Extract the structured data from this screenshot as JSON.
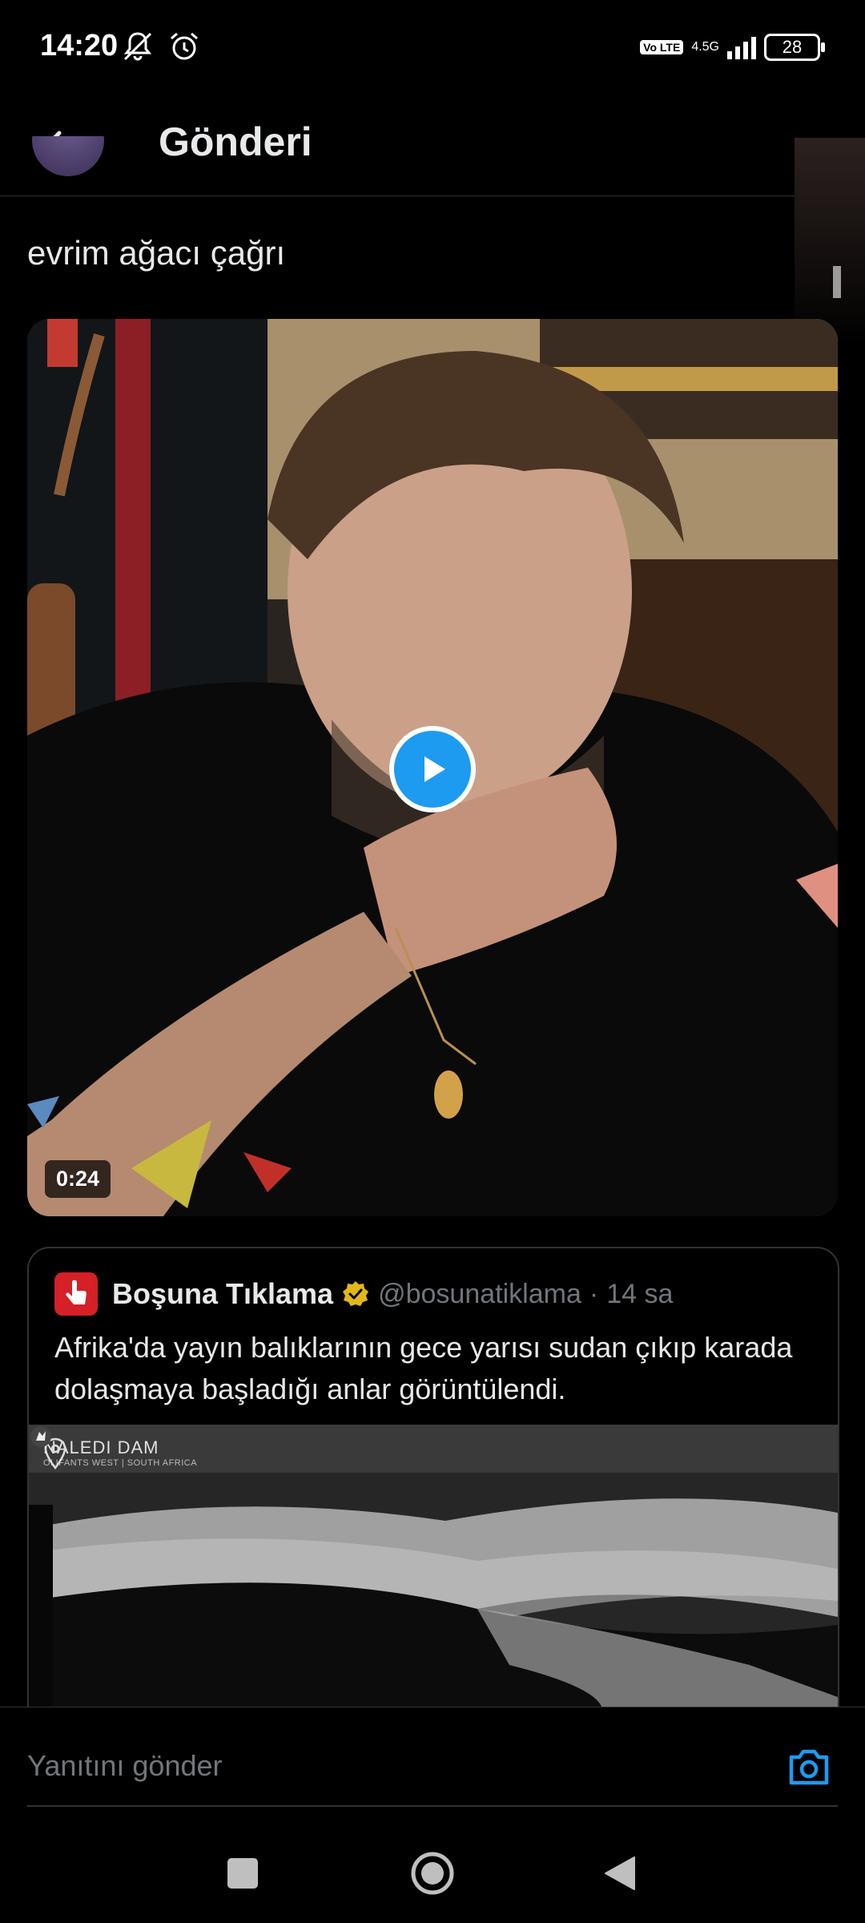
{
  "status_bar": {
    "time": "14:20",
    "network": "4.5G",
    "volte": "Vo LTE",
    "battery": "28"
  },
  "header": {
    "title": "Gönderi"
  },
  "tweet": {
    "text": "evrim ağacı çağrı",
    "video": {
      "duration": "0:24"
    }
  },
  "quote": {
    "name": "Boşuna Tıklama",
    "handle": "@bosunatiklama",
    "separator": "·",
    "time": "14 sa",
    "text": "Afrika'da yayın balıklarının gece yarısı sudan çıkıp karada dolaşmaya başladığı anlar görüntülendi.",
    "media": {
      "location_title": "NALEDI DAM",
      "location_sub": "OLIFANTS WEST | SOUTH AFRICA"
    }
  },
  "reply": {
    "placeholder": "Yanıtını gönder"
  },
  "colors": {
    "accent": "#1d9bf0",
    "background": "#000000",
    "text": "#e7e9ea",
    "muted": "#71767b",
    "verified_gold": "#e2b719",
    "brand_red": "#d42026"
  }
}
